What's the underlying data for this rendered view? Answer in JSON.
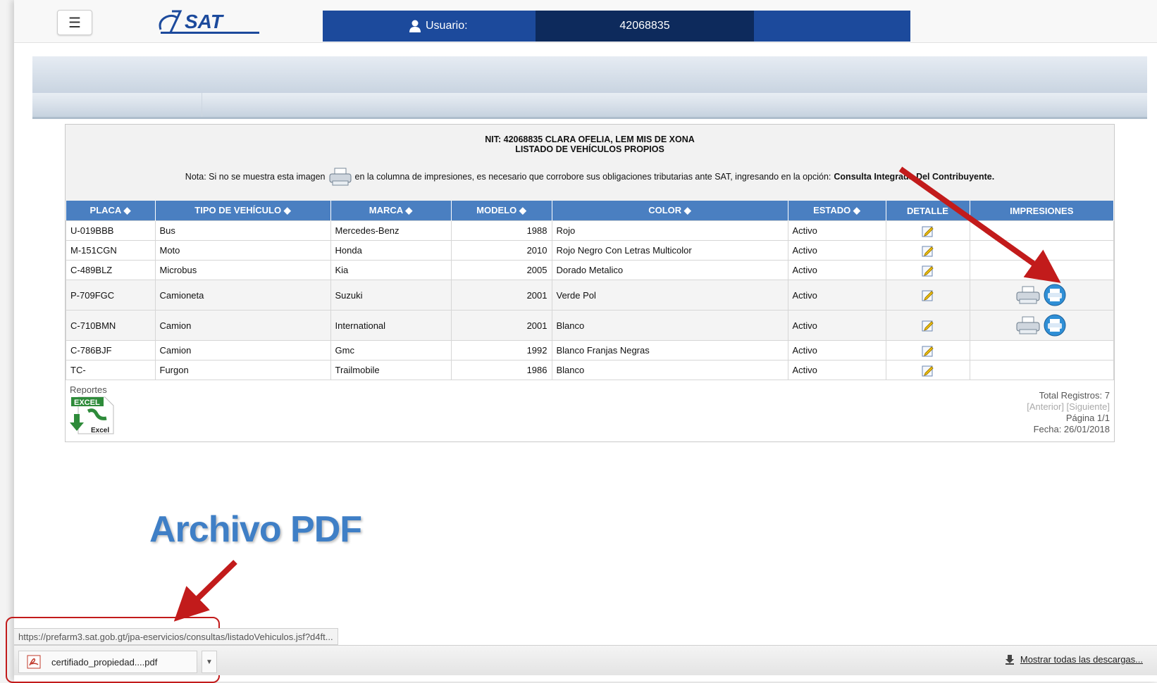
{
  "header": {
    "menu_icon": "hamburger-icon",
    "logo_text": "SAT",
    "user_label": "Usuario:",
    "user_value": "42068835"
  },
  "panel": {
    "nit_line": "NIT: 42068835 CLARA OFELIA, LEM MIS DE XONA",
    "title": "LISTADO DE VEHÍCULOS PROPIOS",
    "nota_prefix": "Nota: Si no se muestra esta imagen",
    "nota_suffix": "en la columna de impresiones, es necesario que corrobore sus obligaciones tributarias ante SAT, ingresando en la opción:",
    "nota_link": "Consulta Integrada Del Contribuyente."
  },
  "table": {
    "headers": [
      "PLACA",
      "TIPO DE VEHÍCULO",
      "MARCA",
      "MODELO",
      "COLOR",
      "ESTADO",
      "DETALLE",
      "IMPRESIONES"
    ],
    "sortable": [
      "PLACA",
      "TIPO DE VEHÍCULO",
      "MARCA",
      "MODELO",
      "COLOR",
      "ESTADO"
    ],
    "rows": [
      {
        "placa": "U-019BBB",
        "tipo": "Bus",
        "marca": "Mercedes-Benz",
        "modelo": "1988",
        "color": "Rojo",
        "estado": "Activo",
        "print": false
      },
      {
        "placa": "M-151CGN",
        "tipo": "Moto",
        "marca": "Honda",
        "modelo": "2010",
        "color": "Rojo Negro Con Letras Multicolor",
        "estado": "Activo",
        "print": false
      },
      {
        "placa": "C-489BLZ",
        "tipo": "Microbus",
        "marca": "Kia",
        "modelo": "2005",
        "color": "Dorado Metalico",
        "estado": "Activo",
        "print": false
      },
      {
        "placa": "P-709FGC",
        "tipo": "Camioneta",
        "marca": "Suzuki",
        "modelo": "2001",
        "color": "Verde Pol",
        "estado": "Activo",
        "print": true
      },
      {
        "placa": "C-710BMN",
        "tipo": "Camion",
        "marca": "International",
        "modelo": "2001",
        "color": "Blanco",
        "estado": "Activo",
        "print": true
      },
      {
        "placa": "C-786BJF",
        "tipo": "Camion",
        "marca": "Gmc",
        "modelo": "1992",
        "color": "Blanco Franjas Negras",
        "estado": "Activo",
        "print": false
      },
      {
        "placa": "TC-",
        "tipo": "Furgon",
        "marca": "Trailmobile",
        "modelo": "1986",
        "color": "Blanco",
        "estado": "Activo",
        "print": false
      }
    ]
  },
  "footer": {
    "reportes": "Reportes",
    "excel_badge": "EXCEL",
    "excel_label": "Excel",
    "total": "Total Registros: 7",
    "pager": "[Anterior] [Siguiente]",
    "page": "Página 1/1",
    "fecha": "Fecha: 26/01/2018"
  },
  "annotation": {
    "archivo": "Archivo PDF",
    "arrow_color": "#c21b1b"
  },
  "browser": {
    "status_url": "https://prefarm3.sat.gob.gt/jpa-eservicios/consultas/listadoVehiculos.jsf?d4ft...",
    "download_name": "certifiado_propiedad....pdf",
    "show_all": "Mostrar todas las descargas..."
  },
  "colors": {
    "header_blue": "#1c4a9c",
    "header_dark": "#0d2a5c",
    "table_header": "#4a7fc1",
    "annotation_blue": "#3f7fc6"
  }
}
